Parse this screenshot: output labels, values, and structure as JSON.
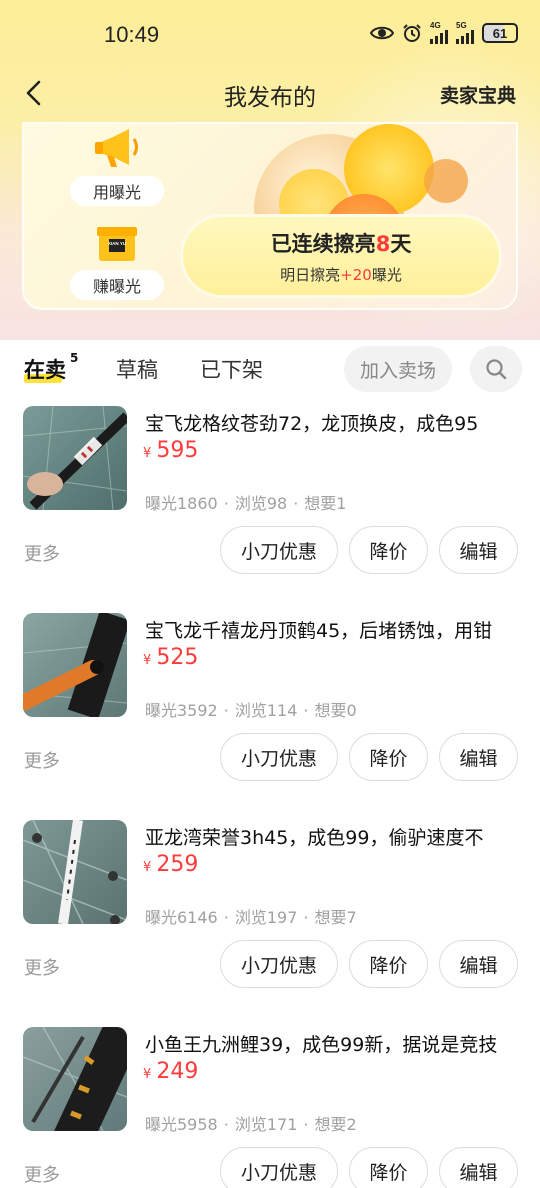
{
  "status_bar": {
    "time": "10:49",
    "net1": "4G",
    "net2": "5G",
    "battery": "61"
  },
  "nav": {
    "title": "我发布的",
    "right_link": "卖家宝典"
  },
  "promo": {
    "use_exposure": "用曝光",
    "earn_exposure": "赚曝光",
    "box_text": "XIAN YU",
    "streak_prefix": "已连续擦亮",
    "streak_days": "8",
    "streak_suffix": "天",
    "tomorrow_prefix": "明日擦亮",
    "tomorrow_bonus": "+20",
    "tomorrow_suffix": "曝光"
  },
  "tabs": {
    "on_sale": "在卖",
    "on_sale_count": "5",
    "drafts": "草稿",
    "delisted": "已下架",
    "join_market": "加入卖场"
  },
  "actions": {
    "more": "更多",
    "small_discount": "小刀优惠",
    "price_drop": "降价",
    "edit": "编辑"
  },
  "listings": [
    {
      "title": "宝飞龙格纹苍劲72，龙顶换皮，成色95",
      "currency": "¥",
      "price": "595",
      "stats": {
        "exposure": "曝光1860",
        "views": "浏览98",
        "wants": "想要1"
      }
    },
    {
      "title": "宝飞龙千禧龙丹顶鹤45，后堵锈蚀，用钳",
      "currency": "¥",
      "price": "525",
      "stats": {
        "exposure": "曝光3592",
        "views": "浏览114",
        "wants": "想要0"
      }
    },
    {
      "title": "亚龙湾荣誉3h45，成色99，偷驴速度不",
      "currency": "¥",
      "price": "259",
      "stats": {
        "exposure": "曝光6146",
        "views": "浏览197",
        "wants": "想要7"
      }
    },
    {
      "title": "小鱼王九洲鲤39，成色99新，据说是竞技",
      "currency": "¥",
      "price": "249",
      "stats": {
        "exposure": "曝光5958",
        "views": "浏览171",
        "wants": "想要2"
      }
    }
  ],
  "colors": {
    "accent_red": "#ff3b3b",
    "accent_yellow": "#ffe33a"
  }
}
